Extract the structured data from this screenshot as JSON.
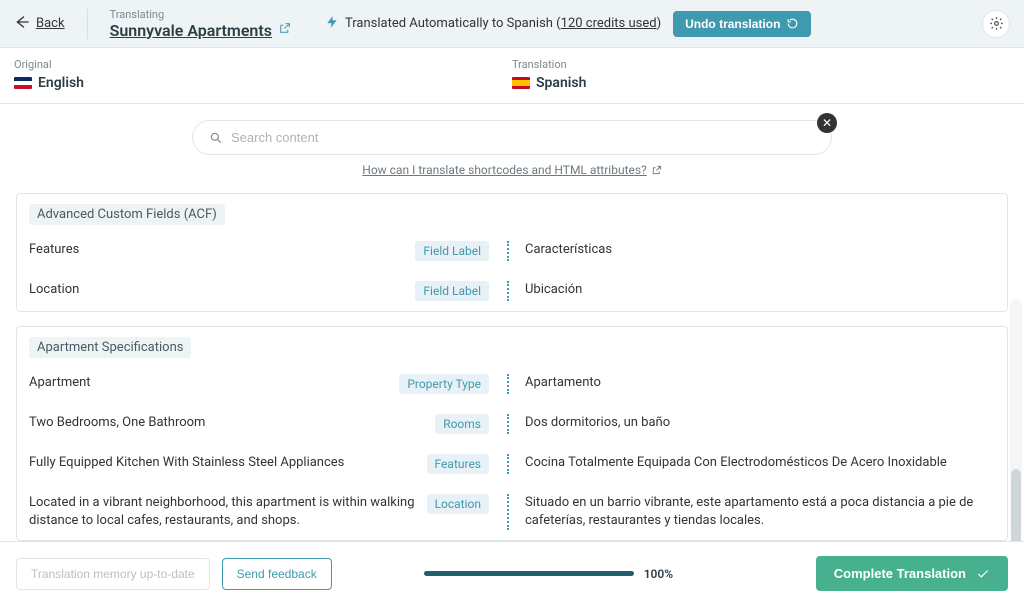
{
  "topbar": {
    "back_label": "Back",
    "translating_label": "Translating",
    "title": "Sunnyvale Apartments",
    "auto_msg_prefix": "Translated Automatically to Spanish (",
    "auto_msg_credits": "120 credits used",
    "auto_msg_suffix": ")",
    "undo_label": "Undo translation"
  },
  "languages": {
    "original_label": "Original",
    "original_name": "English",
    "translation_label": "Translation",
    "translation_name": "Spanish"
  },
  "search": {
    "placeholder": "Search content",
    "help_text": "How can I translate shortcodes and HTML attributes?"
  },
  "sections": [
    {
      "heading": "Advanced Custom Fields (ACF)",
      "rows": [
        {
          "orig": "Features",
          "tag": "Field Label",
          "trans": "Características"
        },
        {
          "orig": "Location",
          "tag": "Field Label",
          "trans": "Ubicación"
        }
      ]
    },
    {
      "heading": "Apartment Specifications",
      "rows": [
        {
          "orig": "Apartment",
          "tag": "Property Type",
          "trans": "Apartamento"
        },
        {
          "orig": "Two Bedrooms, One Bathroom",
          "tag": "Rooms",
          "trans": "Dos dormitorios, un baño"
        },
        {
          "orig": "Fully Equipped Kitchen With Stainless Steel Appliances",
          "tag": "Features",
          "trans": "Cocina Totalmente Equipada Con Electrodomésticos De Acero Inoxidable"
        },
        {
          "orig": "Located in a vibrant neighborhood, this apartment is within walking distance to local cafes, restaurants, and shops.",
          "tag": "Location",
          "trans": "Situado en un barrio vibrante, este apartamento está a poca distancia a pie de cafeterías, restaurantes y tiendas locales."
        }
      ]
    }
  ],
  "footer": {
    "memory_label": "Translation memory up-to-date",
    "feedback_label": "Send feedback",
    "progress_pct": "100%",
    "complete_label": "Complete Translation"
  }
}
